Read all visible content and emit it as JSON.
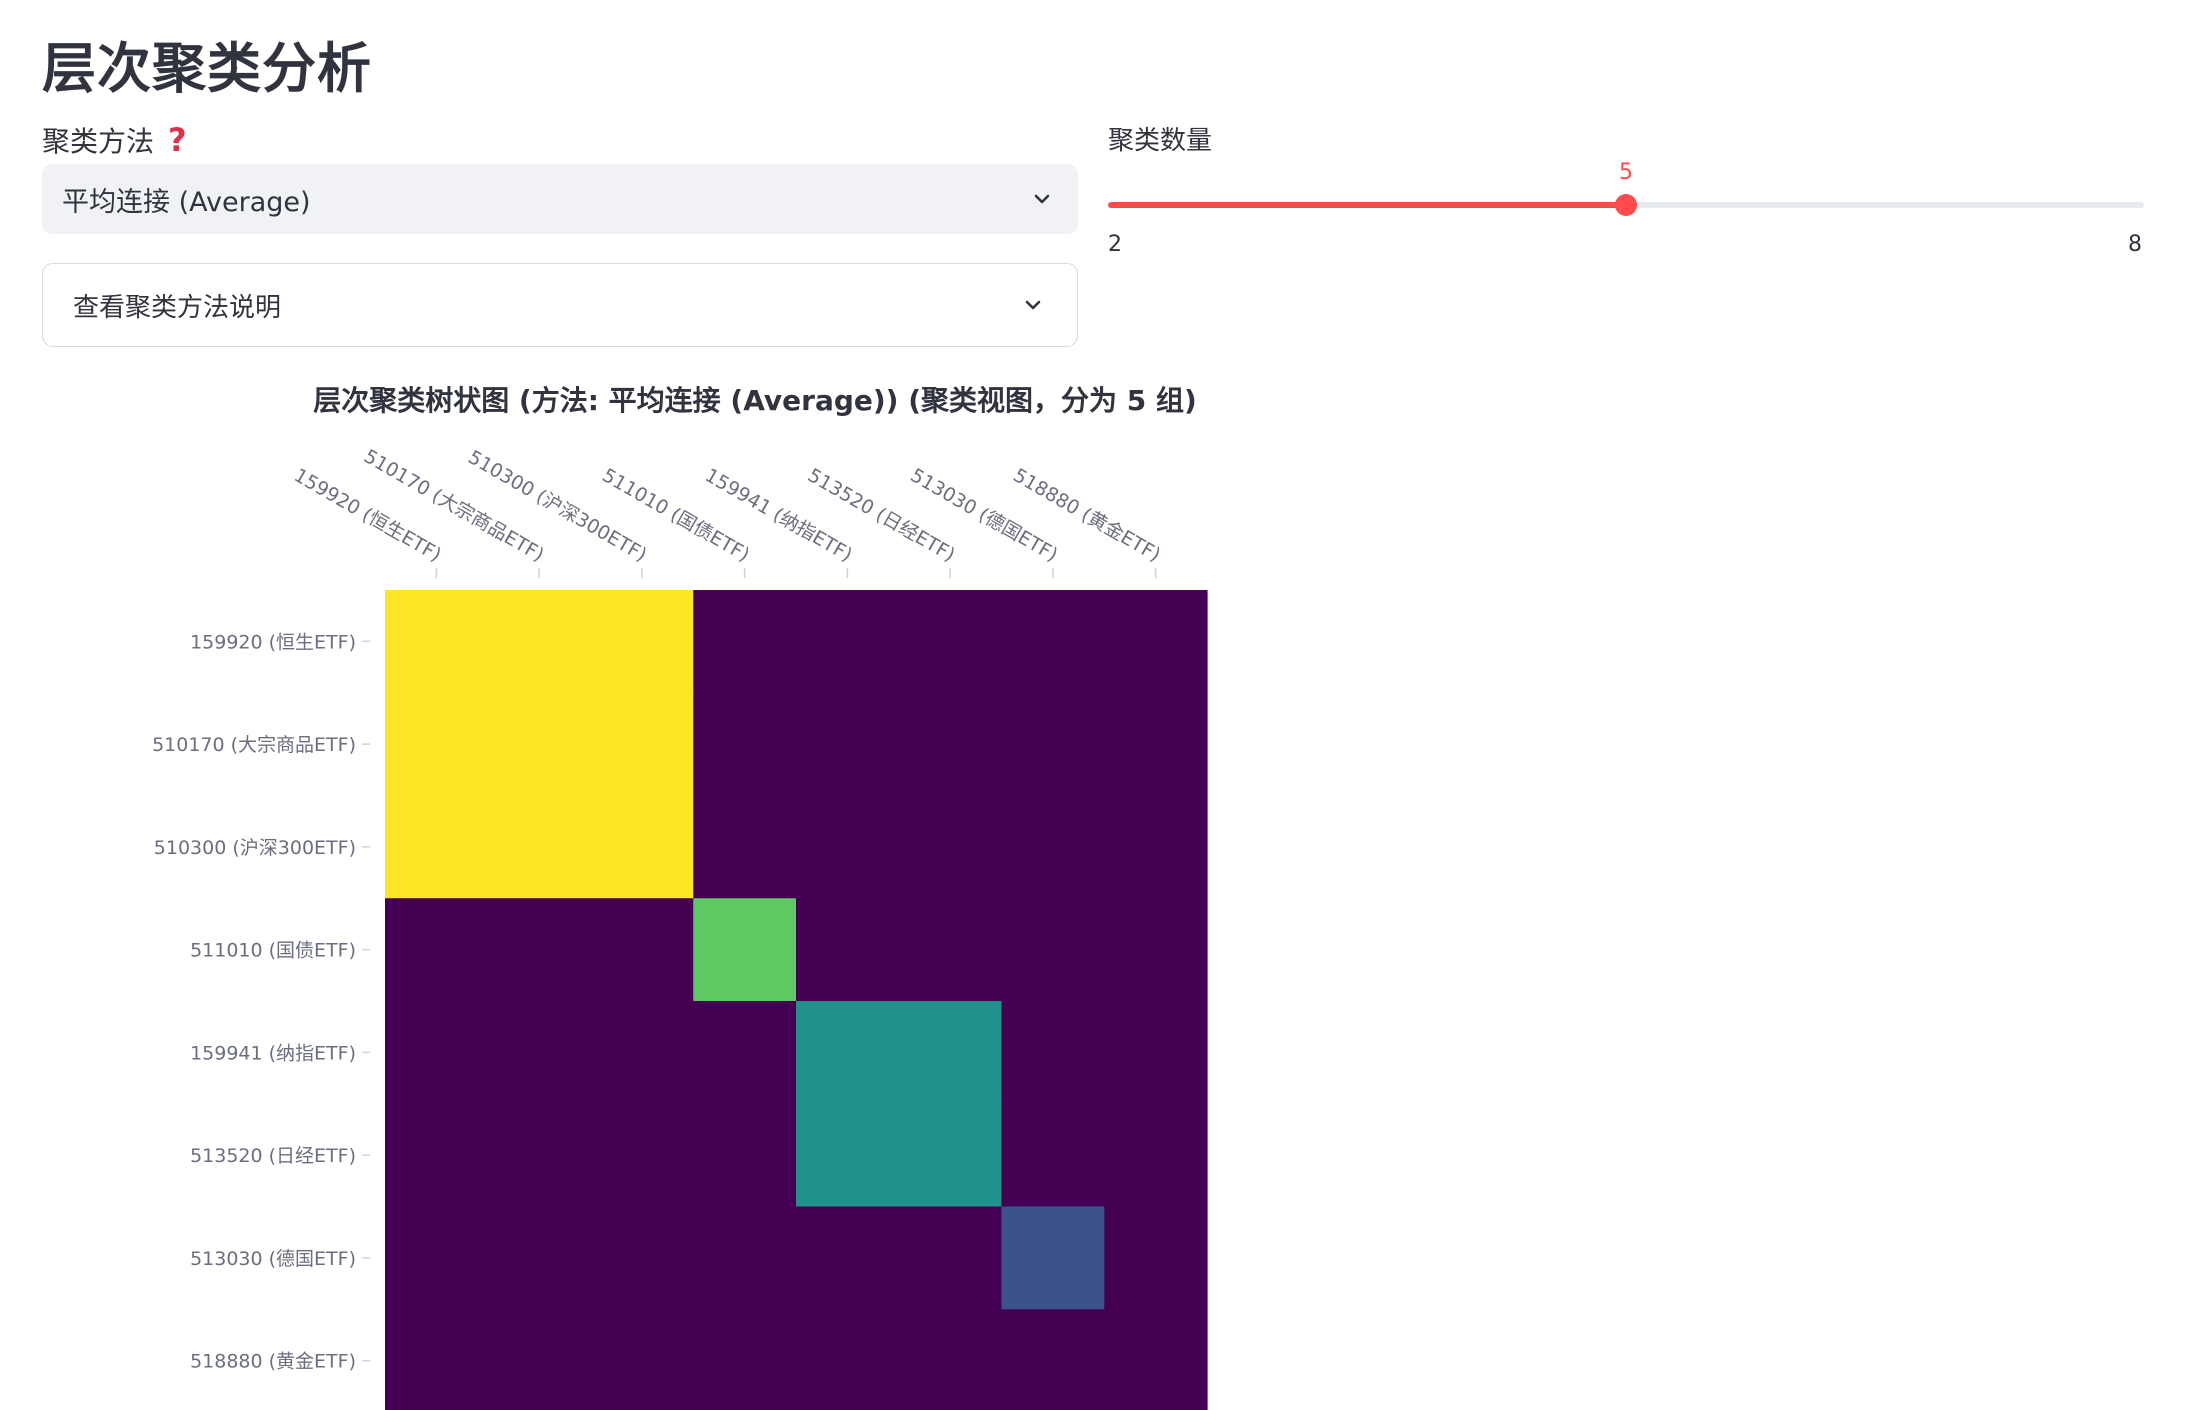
{
  "page": {
    "title": "层次聚类分析"
  },
  "controls": {
    "method_label": "聚类方法",
    "help_icon": "question-mark-icon",
    "method_value": "平均连接 (Average)",
    "expander_label": "查看聚类方法说明",
    "count_label": "聚类数量",
    "count_value": "5",
    "count_min": "2",
    "count_max": "8",
    "count_fraction": 0.5,
    "accent_color": "#ff4b4b"
  },
  "chart_data": {
    "type": "heatmap",
    "title": "层次聚类树状图 (方法: 平均连接 (Average)) (聚类视图，分为 5 组)",
    "x_labels": [
      "159920 (恒生ETF)",
      "510170 (大宗商品ETF)",
      "510300 (沪深300ETF)",
      "511010 (国债ETF)",
      "159941 (纳指ETF)",
      "513520 (日经ETF)",
      "513030 (德国ETF)",
      "518880 (黄金ETF)"
    ],
    "y_labels": [
      "159920 (恒生ETF)",
      "510170 (大宗商品ETF)",
      "510300 (沪深300ETF)",
      "511010 (国债ETF)",
      "159941 (纳指ETF)",
      "513520 (日经ETF)",
      "513030 (德国ETF)",
      "518880 (黄金ETF)"
    ],
    "z": [
      [
        4,
        4,
        4,
        0,
        0,
        0,
        0,
        0
      ],
      [
        4,
        4,
        4,
        0,
        0,
        0,
        0,
        0
      ],
      [
        4,
        4,
        4,
        0,
        0,
        0,
        0,
        0
      ],
      [
        0,
        0,
        0,
        3,
        0,
        0,
        0,
        0
      ],
      [
        0,
        0,
        0,
        0,
        2,
        2,
        0,
        0
      ],
      [
        0,
        0,
        0,
        0,
        2,
        2,
        0,
        0
      ],
      [
        0,
        0,
        0,
        0,
        0,
        0,
        1,
        0
      ],
      [
        0,
        0,
        0,
        0,
        0,
        0,
        0,
        0
      ]
    ],
    "colorscale": [
      "#440154",
      "#3b528b",
      "#21918c",
      "#5ec962",
      "#fde725"
    ],
    "x_axis_position": "top",
    "grid": false
  }
}
